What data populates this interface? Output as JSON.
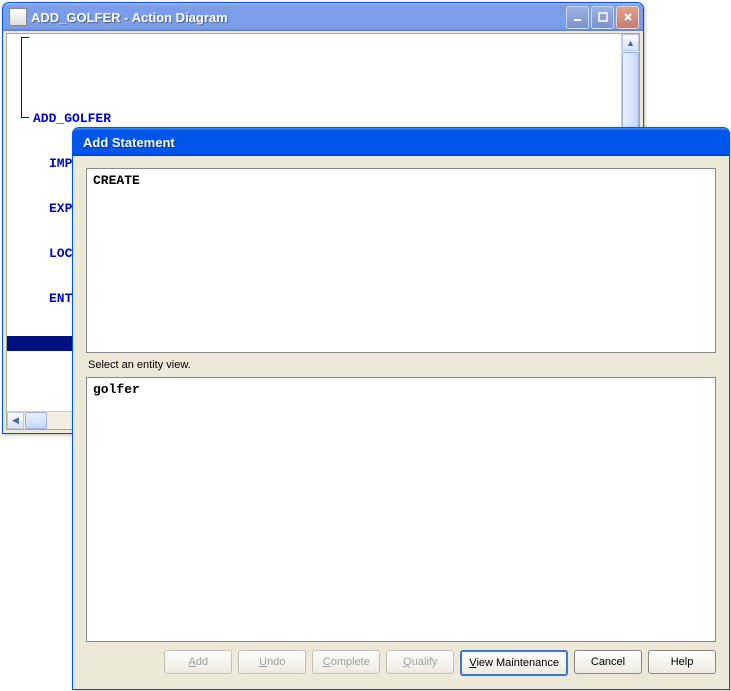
{
  "main_window": {
    "title": "ADD_GOLFER - Action Diagram",
    "code": {
      "line1": "ADD_GOLFER",
      "line2": "IMPORTS:",
      "line3": "EXPORTS:",
      "line4": "LOCALS:",
      "line5": "ENTITY ACTIONS: ..."
    }
  },
  "dialog": {
    "title": "Add Statement",
    "upper_text": "CREATE",
    "prompt": "Select an entity view.",
    "lower_text": "golfer",
    "buttons": {
      "add": "Add",
      "undo": "Undo",
      "complete": "Complete",
      "qualify": "Qualify",
      "view_maintenance": "View Maintenance",
      "cancel": "Cancel",
      "help": "Help"
    }
  }
}
